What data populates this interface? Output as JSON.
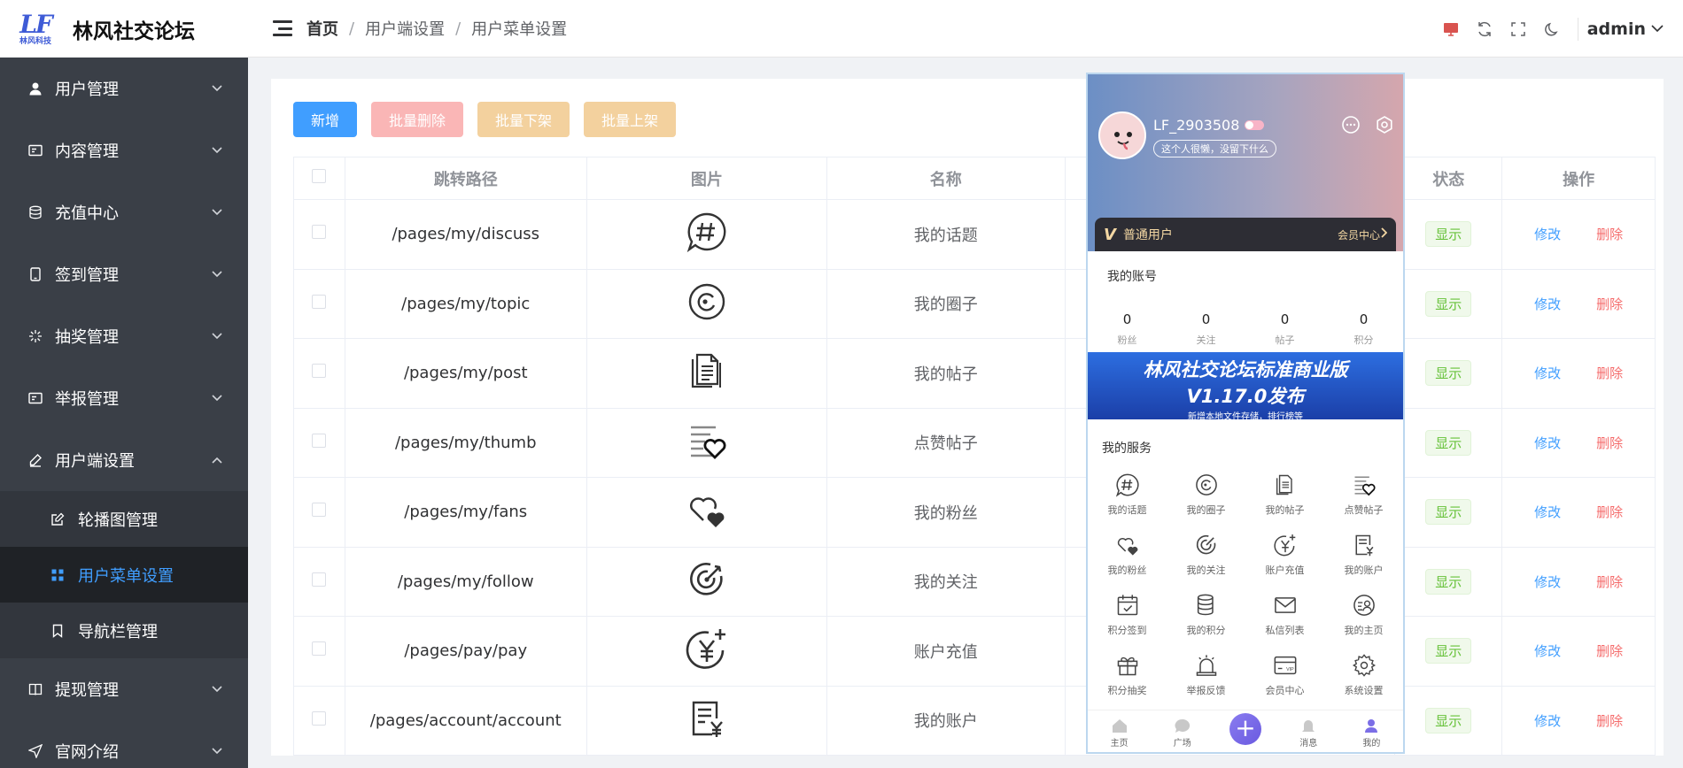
{
  "brand": {
    "logo_text": "LF",
    "logo_sub": "林风科技",
    "title": "林风社交论坛"
  },
  "sidebar": {
    "items": [
      {
        "label": "用户管理"
      },
      {
        "label": "内容管理"
      },
      {
        "label": "充值中心"
      },
      {
        "label": "签到管理"
      },
      {
        "label": "抽奖管理"
      },
      {
        "label": "举报管理"
      },
      {
        "label": "用户端设置"
      },
      {
        "label": "提现管理"
      },
      {
        "label": "官网介绍"
      }
    ],
    "submenu": [
      {
        "label": "轮播图管理"
      },
      {
        "label": "用户菜单设置"
      },
      {
        "label": "导航栏管理"
      }
    ]
  },
  "header": {
    "breadcrumb": [
      "首页",
      "用户端设置",
      "用户菜单设置"
    ],
    "user": "admin"
  },
  "toolbar": {
    "add": "新增",
    "batch_delete": "批量删除",
    "batch_off": "批量下架",
    "batch_on": "批量上架"
  },
  "table": {
    "headers": {
      "path": "跳转路径",
      "image": "图片",
      "name": "名称",
      "status": "状态",
      "ops": "操作"
    },
    "rows": [
      {
        "path": "/pages/my/discuss",
        "icon": "hashtag-bubble-icon",
        "name": "我的话题",
        "status": "显示"
      },
      {
        "path": "/pages/my/topic",
        "icon": "circle-target-icon",
        "name": "我的圈子",
        "status": "显示"
      },
      {
        "path": "/pages/my/post",
        "icon": "documents-icon",
        "name": "我的帖子",
        "status": "显示"
      },
      {
        "path": "/pages/my/thumb",
        "icon": "list-heart-icon",
        "name": "点赞帖子",
        "status": "显示"
      },
      {
        "path": "/pages/my/fans",
        "icon": "hearts-icon",
        "name": "我的粉丝",
        "status": "显示"
      },
      {
        "path": "/pages/my/follow",
        "icon": "target-arrow-icon",
        "name": "我的关注",
        "status": "显示"
      },
      {
        "path": "/pages/pay/pay",
        "icon": "yen-plus-icon",
        "name": "账户充值",
        "status": "显示"
      },
      {
        "path": "/pages/account/account",
        "icon": "bill-yen-icon",
        "name": "我的账户",
        "status": "显示"
      }
    ],
    "edit_label": "修改",
    "delete_label": "删除"
  },
  "phone": {
    "username": "LF_2903508",
    "bio": "这个人很懒，没留下什么",
    "vip_title": "普通用户",
    "vip_link": "会员中心",
    "account_title": "我的账号",
    "stats": [
      {
        "n": "0",
        "l": "粉丝"
      },
      {
        "n": "0",
        "l": "关注"
      },
      {
        "n": "0",
        "l": "帖子"
      },
      {
        "n": "0",
        "l": "积分"
      }
    ],
    "banner": {
      "line1": "林风社交论坛标准商业版",
      "line2": "V1.17.0发布",
      "line3": "新增本地文件存储，排行榜等"
    },
    "services_title": "我的服务",
    "services": [
      {
        "l": "我的话题",
        "icon": "hashtag-bubble-icon"
      },
      {
        "l": "我的圈子",
        "icon": "circle-target-icon"
      },
      {
        "l": "我的帖子",
        "icon": "documents-icon"
      },
      {
        "l": "点赞帖子",
        "icon": "list-heart-icon"
      },
      {
        "l": "我的粉丝",
        "icon": "hearts-icon"
      },
      {
        "l": "我的关注",
        "icon": "target-arrow-icon"
      },
      {
        "l": "账户充值",
        "icon": "yen-plus-icon"
      },
      {
        "l": "我的账户",
        "icon": "bill-yen-icon"
      },
      {
        "l": "积分签到",
        "icon": "calendar-check-icon"
      },
      {
        "l": "我的积分",
        "icon": "coins-icon"
      },
      {
        "l": "私信列表",
        "icon": "mail-icon"
      },
      {
        "l": "我的主页",
        "icon": "person-list-icon"
      },
      {
        "l": "积分抽奖",
        "icon": "gift-icon"
      },
      {
        "l": "举报反馈",
        "icon": "alarm-icon"
      },
      {
        "l": "会员中心",
        "icon": "vip-card-icon"
      },
      {
        "l": "系统设置",
        "icon": "gear-icon"
      }
    ],
    "tabs": [
      {
        "l": "主页"
      },
      {
        "l": "广场"
      },
      {
        "l": ""
      },
      {
        "l": "消息"
      },
      {
        "l": "我的"
      }
    ]
  },
  "colors": {
    "primary": "#409eff",
    "danger": "#f56c6c",
    "success": "#67c23a",
    "sidebar": "#3a3f47"
  }
}
